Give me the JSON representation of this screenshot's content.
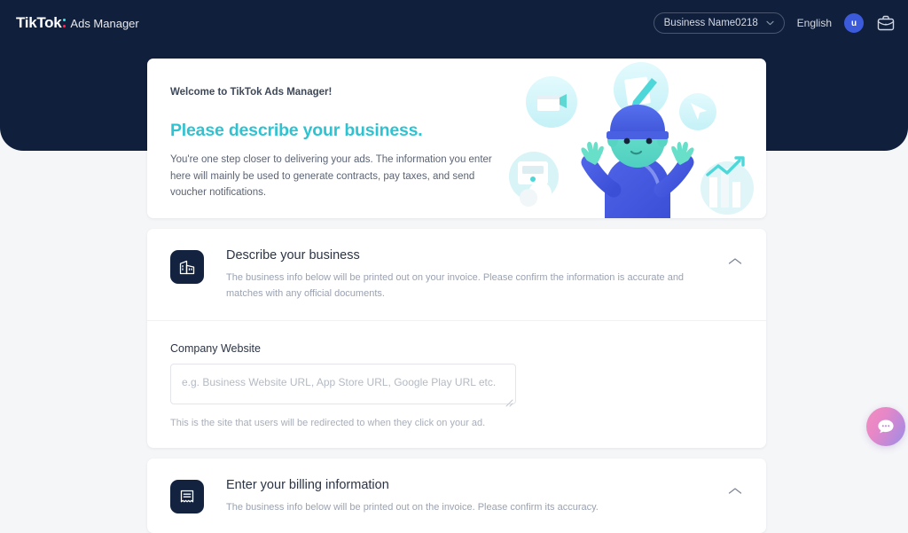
{
  "nav": {
    "brand_main": "TikTok",
    "brand_sub": "Ads Manager",
    "business_name": "Business Name0218",
    "business_chevron": "⌄",
    "language": "English",
    "avatar_initial": "u",
    "briefcase_icon": "briefcase-icon"
  },
  "banner": {
    "welcome": "Welcome to TikTok Ads Manager!",
    "headline": "Please describe your business.",
    "blurb": "You're one step closer to delivering your ads. The information you enter here will mainly be used to generate contracts, pay taxes, and send voucher notifications.",
    "illustration_name": "juggling-person-illustration"
  },
  "describe_section": {
    "icon": "building-icon",
    "title": "Describe your business",
    "description": "The business info below will be printed out on your invoice. Please confirm the information is accurate and matches with any official documents.",
    "collapse_icon": "chevron-up-icon",
    "field_label": "Company Website",
    "field_value": "",
    "field_placeholder": "e.g. Business Website URL, App Store URL, Google Play URL etc.",
    "field_help": "This is the site that users will be redirected to when they click on your ad."
  },
  "billing_section": {
    "icon": "invoice-icon",
    "title": "Enter your billing information",
    "description": "The business info below will be printed out on the invoice. Please confirm its accuracy.",
    "collapse_icon": "chevron-up-icon"
  },
  "chat_widget": {
    "icon": "chat-bubble-icon",
    "label": "Support chat"
  },
  "colors": {
    "header_navy": "#101f3c",
    "headline_teal": "#2fc3d2",
    "page_background": "#f5f6f8",
    "icon_tile_navy": "#12223f",
    "avatar_blue": "#3b5bdb",
    "tiktok_cyan": "#25f4ee",
    "tiktok_red": "#fe2c55"
  }
}
